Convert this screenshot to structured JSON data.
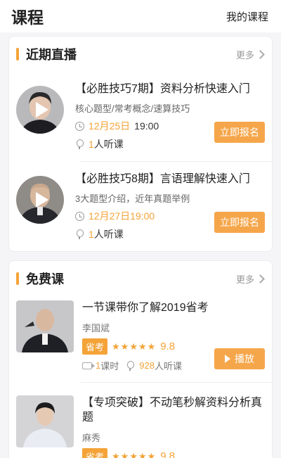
{
  "header": {
    "title": "课程",
    "mine": "我的课程"
  },
  "live": {
    "title": "近期直播",
    "more": "更多",
    "items": [
      {
        "title": "【必胜技巧7期】资料分析快速入门",
        "sub": "核心题型/常考概念/速算技巧",
        "date": "12月25日",
        "time": "19:00",
        "count": "1",
        "count_suffix": "人听课",
        "button": "立即报名"
      },
      {
        "title": "【必胜技巧8期】言语理解快速入门",
        "sub": "3大题型介绍，近年真题举例",
        "date": "12月27日19:00",
        "time": "",
        "count": "1",
        "count_suffix": "人听课",
        "button": "立即报名"
      }
    ]
  },
  "free": {
    "title": "免费课",
    "more": "更多",
    "items": [
      {
        "title": "一节课带你了解2019省考",
        "teacher": "李国斌",
        "tag": "省考",
        "stars": "★★★★★",
        "score": "9.8",
        "lessons": "1",
        "lessons_suffix": "课时",
        "listeners": "928",
        "listeners_suffix": "人听课",
        "button": "播放"
      },
      {
        "title": "【专项突破】不动笔秒解资料分析真题",
        "teacher": "麻秀",
        "tag": "省考",
        "stars": "★★★★★",
        "score": "9.8"
      }
    ]
  },
  "colors": {
    "accent": "#f4a338",
    "button": "#f6a64a"
  }
}
